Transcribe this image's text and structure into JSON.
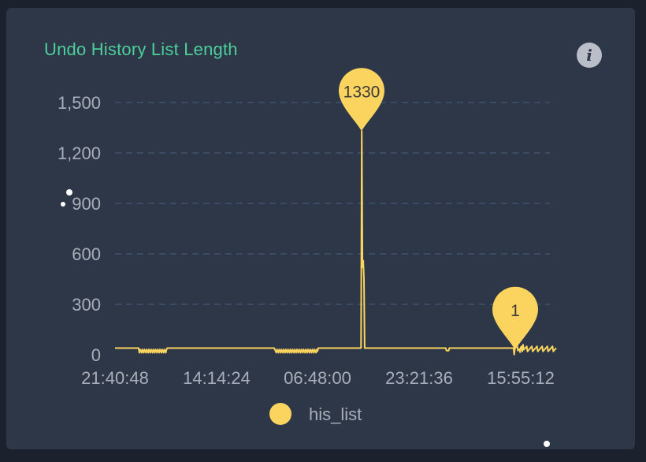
{
  "panel": {
    "title": "Undo History List Length",
    "info_icon": "info-icon"
  },
  "colors": {
    "background": "#2e3748",
    "title": "#4ccf9a",
    "series": "#fad45e",
    "grid": "#3f5270",
    "axis_text": "#a9afba"
  },
  "chart_data": {
    "type": "line",
    "title": "Undo History List Length",
    "xlabel": "",
    "ylabel": "",
    "ylim": [
      0,
      1500
    ],
    "yticks": [
      0,
      300,
      600,
      900,
      1200,
      1500
    ],
    "ytick_labels": [
      "0",
      "300",
      "600",
      "900",
      "1,200",
      "1,500"
    ],
    "xtick_labels": [
      "21:40:48",
      "14:14:24",
      "06:48:00",
      "23:21:36",
      "15:55:12"
    ],
    "grid": true,
    "legend_position": "bottom-center",
    "series": [
      {
        "name": "his_list",
        "color": "#fad45e",
        "values": [
          40,
          40,
          40,
          40,
          40,
          40,
          40,
          40,
          40,
          40,
          40,
          40,
          40,
          40,
          40,
          40,
          40,
          40,
          40,
          40,
          40,
          40,
          40,
          40,
          40,
          40,
          40,
          40,
          40,
          40,
          40,
          40,
          40,
          40,
          40,
          40,
          40,
          40,
          40,
          40,
          40,
          40,
          40,
          40,
          40,
          40,
          40,
          40,
          40,
          40,
          40,
          40,
          40,
          40,
          40,
          40,
          40,
          40,
          40,
          40,
          40,
          40,
          40,
          40,
          40,
          40,
          40,
          40,
          40,
          40,
          40,
          40,
          40,
          40,
          40,
          40,
          40,
          40,
          40,
          40,
          40,
          40,
          40,
          40,
          40,
          40,
          40,
          40,
          40,
          40,
          40,
          40,
          40,
          40,
          40,
          40,
          40,
          40,
          40,
          40,
          40,
          40,
          40,
          40,
          40,
          40,
          40,
          40,
          40,
          40,
          40,
          40,
          40,
          40,
          40,
          40,
          40,
          40,
          40,
          40,
          40,
          40,
          40,
          40,
          40,
          40,
          40,
          40,
          40,
          40,
          40,
          40,
          40,
          40,
          40,
          40,
          40,
          40,
          40,
          40,
          40,
          40,
          40,
          40,
          40,
          40,
          40,
          40,
          40,
          40,
          40,
          40,
          40,
          40,
          40,
          40,
          40,
          40,
          40,
          40,
          40,
          40,
          40,
          40,
          40,
          40,
          40,
          40,
          40,
          40,
          40,
          40,
          40,
          40,
          40,
          40,
          40,
          40,
          40,
          40,
          40,
          40,
          40,
          40,
          40,
          40,
          40,
          40,
          40,
          40,
          40,
          40,
          40,
          40,
          40,
          40,
          40,
          40,
          40,
          40,
          40,
          40,
          40,
          40,
          40,
          40,
          40,
          40,
          40,
          40,
          40,
          40,
          40,
          40,
          40,
          40,
          40,
          40,
          40,
          40,
          40,
          40,
          40,
          40,
          40,
          40,
          40,
          40,
          40,
          40,
          40,
          40,
          40,
          40,
          40,
          40,
          40,
          40,
          40,
          40,
          40,
          40,
          40,
          40,
          40,
          40,
          40,
          40,
          40,
          40,
          40,
          40,
          40,
          40,
          40,
          40,
          40,
          40,
          40,
          40,
          40,
          40,
          40,
          40,
          40,
          40,
          40,
          40,
          40,
          40,
          40,
          40,
          40,
          40,
          40,
          40,
          40,
          40,
          40,
          40,
          40,
          40,
          40,
          40,
          40,
          40,
          40,
          40,
          40,
          40,
          40,
          40,
          40,
          40,
          40,
          40,
          40,
          40,
          40,
          40,
          40,
          40,
          40,
          40,
          40,
          40,
          40,
          40,
          40,
          40,
          40,
          40,
          40,
          40,
          40,
          40,
          40,
          40,
          40,
          40,
          40,
          40,
          40,
          40,
          40,
          40,
          40,
          40,
          40,
          40,
          40,
          40,
          40,
          40,
          40,
          40,
          40,
          40,
          40,
          40,
          40,
          40,
          40,
          40,
          40,
          40,
          40,
          40,
          40,
          40,
          40,
          40,
          40,
          40,
          40,
          40,
          40,
          40,
          40,
          40,
          40,
          40,
          40,
          40,
          40,
          40,
          40,
          40,
          40,
          40,
          40,
          40,
          40,
          40,
          40,
          40,
          40,
          40,
          40,
          40,
          40,
          40,
          40,
          40,
          40,
          40,
          40,
          40,
          40,
          40,
          40,
          40,
          40,
          40,
          40,
          40,
          40,
          40,
          40,
          40,
          40,
          40,
          40,
          40,
          40,
          40,
          40,
          40,
          40,
          40,
          40,
          40,
          40,
          40,
          40,
          40,
          40,
          40,
          40,
          40,
          40,
          40,
          40,
          40,
          40,
          40,
          40,
          40,
          40,
          40,
          40,
          40,
          40,
          40,
          40,
          40,
          40,
          40,
          40,
          40,
          40,
          40,
          40,
          40,
          40,
          40,
          40,
          40,
          40,
          40,
          40,
          40,
          40,
          40,
          40,
          40,
          40,
          40,
          40,
          40,
          40,
          40,
          40,
          40,
          40,
          40,
          40,
          40,
          40,
          40,
          40,
          40,
          40,
          40,
          40,
          40,
          40,
          40,
          40,
          40,
          40,
          40,
          40,
          40,
          40,
          40,
          40,
          40,
          40,
          40,
          40,
          40,
          40,
          40,
          40,
          40,
          40,
          40,
          40,
          40,
          40,
          40,
          40,
          40,
          40,
          40,
          40,
          40,
          40,
          40,
          40,
          40,
          40,
          40,
          40,
          40,
          40,
          40,
          40,
          40,
          40,
          40,
          40,
          40,
          40,
          40,
          40,
          40,
          40,
          40,
          40,
          40,
          40,
          40,
          40,
          40,
          40,
          40,
          40,
          40,
          40,
          40,
          40,
          40,
          40,
          40,
          40,
          40,
          40,
          40,
          40,
          40,
          40,
          40,
          40,
          40,
          40,
          40,
          40,
          40,
          40,
          40,
          40,
          40,
          40,
          40,
          40,
          40,
          40,
          40,
          40,
          40,
          40,
          40,
          40,
          40,
          40,
          40,
          40,
          40,
          40,
          40,
          40,
          40,
          40,
          40,
          40,
          40,
          40,
          40,
          40,
          40,
          40,
          40,
          40,
          40,
          40,
          40,
          40,
          40
        ]
      }
    ],
    "markers": [
      {
        "label": "1330",
        "value": 1330,
        "type": "max"
      },
      {
        "label": "1",
        "value": 1,
        "type": "min"
      }
    ]
  },
  "legend": {
    "items": [
      {
        "label": "his_list",
        "color": "#fad45e"
      }
    ]
  }
}
